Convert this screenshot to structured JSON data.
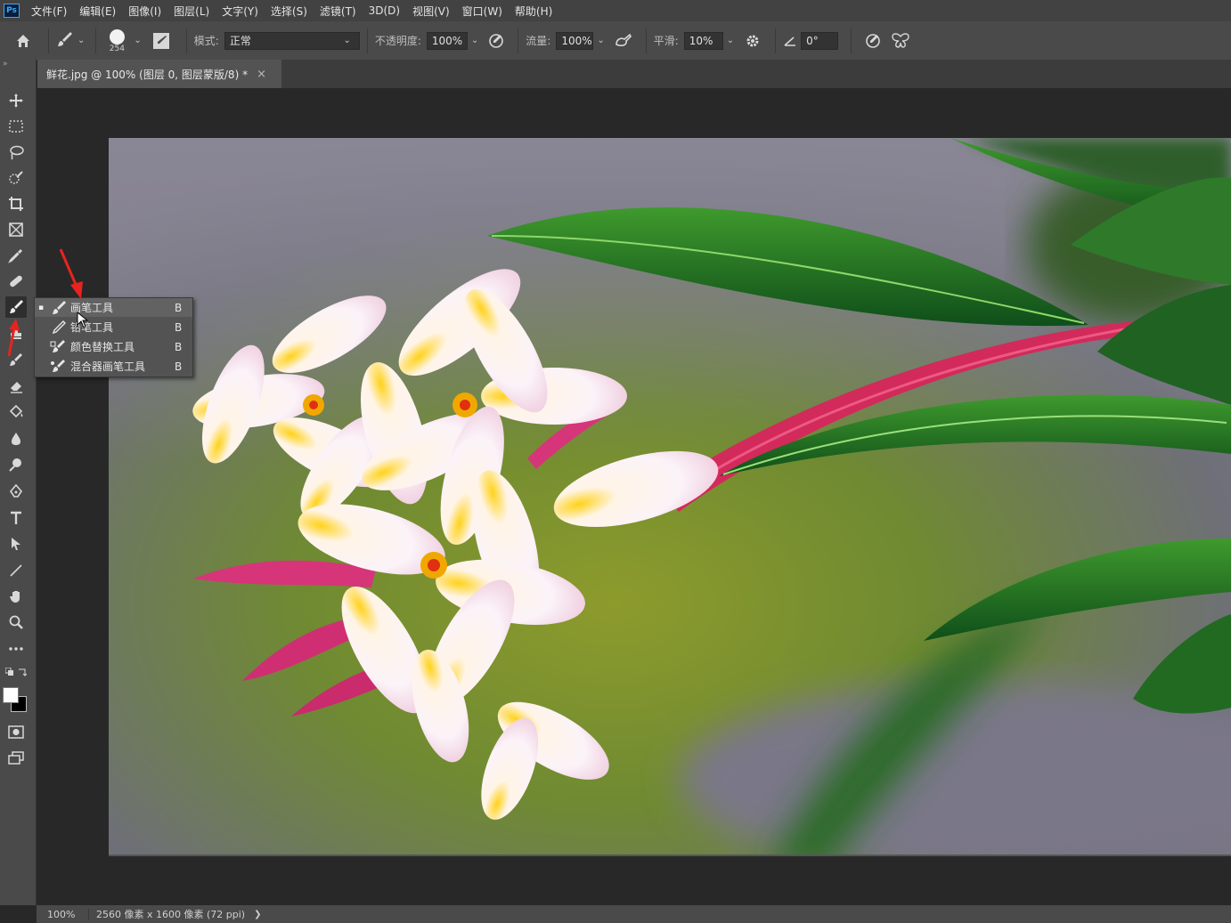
{
  "app": {
    "logo": "Ps"
  },
  "menu": [
    "文件(F)",
    "编辑(E)",
    "图像(I)",
    "图层(L)",
    "文字(Y)",
    "选择(S)",
    "滤镜(T)",
    "3D(D)",
    "视图(V)",
    "窗口(W)",
    "帮助(H)"
  ],
  "options": {
    "brush_size": "254",
    "mode_label": "模式:",
    "mode_value": "正常",
    "opacity_label": "不透明度:",
    "opacity_value": "100%",
    "flow_label": "流量:",
    "flow_value": "100%",
    "smoothing_label": "平滑:",
    "smoothing_value": "10%",
    "angle_value": "0°"
  },
  "tab": {
    "title": "鲜花.jpg @ 100% (图层 0, 图层蒙版/8) *",
    "close": "×"
  },
  "toolbox": {
    "collapse": "»"
  },
  "flyout": {
    "items": [
      {
        "label": "画笔工具",
        "key": "B",
        "icon": "brush-icon",
        "selected": true
      },
      {
        "label": "铅笔工具",
        "key": "B",
        "icon": "pencil-icon",
        "selected": false
      },
      {
        "label": "颜色替换工具",
        "key": "B",
        "icon": "color-replace-icon",
        "selected": false
      },
      {
        "label": "混合器画笔工具",
        "key": "B",
        "icon": "mixer-brush-icon",
        "selected": false
      }
    ],
    "selected_mark": "▪"
  },
  "status": {
    "zoom": "100%",
    "doc_info": "2560 像素 x 1600 像素 (72 ppi)",
    "arrow": "❯"
  },
  "colors": {
    "annotation_arrow": "#e8231f",
    "foreground": "#ffffff",
    "background": "#000000"
  }
}
